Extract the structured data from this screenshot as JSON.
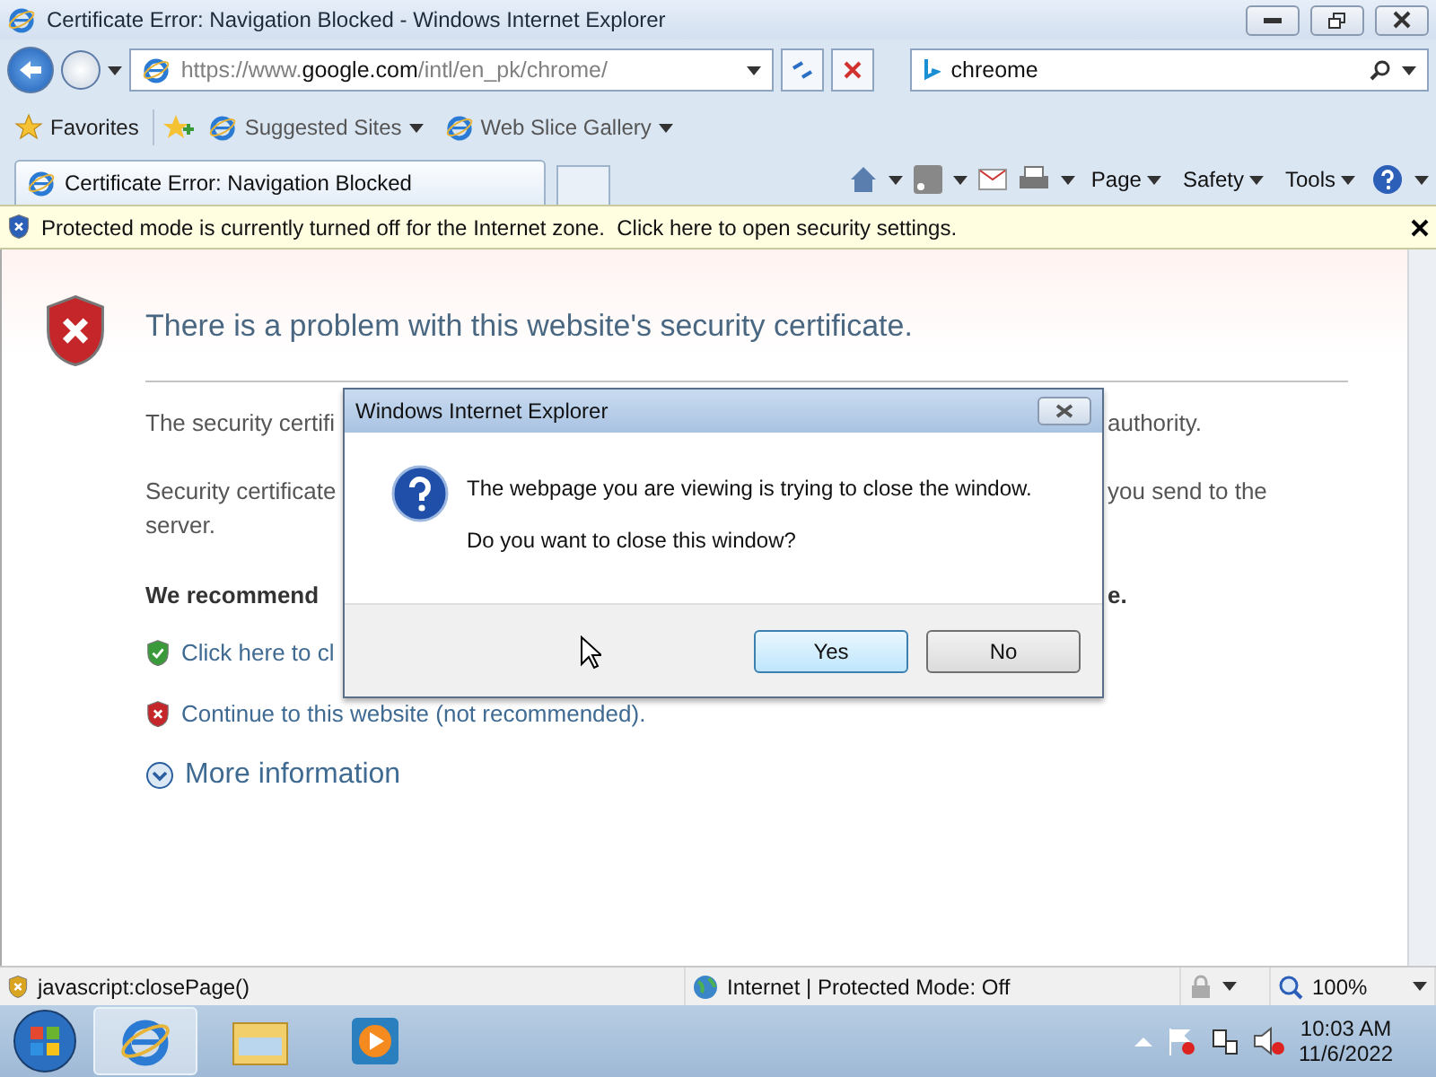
{
  "window": {
    "title": "Certificate Error: Navigation Blocked - Windows Internet Explorer"
  },
  "address_bar": {
    "url": [
      {
        "text": "https://www.",
        "emphasis": false
      },
      {
        "text": "google.com",
        "emphasis": true
      },
      {
        "text": "/intl/en_pk/chrome/",
        "emphasis": false
      }
    ]
  },
  "search": {
    "value": "chreome"
  },
  "favorites_bar": {
    "favorites": "Favorites",
    "links": [
      "Suggested Sites",
      "Web Slice Gallery"
    ]
  },
  "tabs": [
    {
      "label": "Certificate Error: Navigation Blocked",
      "selected": true
    }
  ],
  "command_bar": [
    "Page",
    "Safety",
    "Tools"
  ],
  "info_bar": {
    "message": "Protected mode is currently turned off for the Internet zone.  Click here to open security settings."
  },
  "page": {
    "heading": "There is a problem with this website's security certificate.",
    "rows": [
      {
        "kind": "text",
        "left": "The security certifi",
        "right": "authority."
      },
      {
        "kind": "text",
        "left": "Security certificate",
        "right": "you send to the"
      },
      {
        "kind": "cont",
        "left": "server."
      },
      {
        "kind": "bold",
        "left": "We recommend",
        "right": "e."
      },
      {
        "kind": "safe-link",
        "left": "Click here to cl"
      },
      {
        "kind": "unsafe-link",
        "left": "Continue to this website (not recommended)."
      },
      {
        "kind": "more",
        "left": "More information"
      }
    ]
  },
  "dialog": {
    "title": "Windows Internet Explorer",
    "message": "The webpage you are viewing is trying to close the window.",
    "question": "Do you want to close this window?",
    "buttons": [
      {
        "label": "Yes",
        "default": true
      },
      {
        "label": "No",
        "default": false
      }
    ]
  },
  "status_bar": {
    "url": "javascript:closePage()",
    "zone": "Internet | Protected Mode: Off",
    "zoom": "100%"
  },
  "taskbar": {
    "apps": [
      {
        "kind": "ie",
        "active": true
      },
      {
        "kind": "folder",
        "active": false
      },
      {
        "kind": "media",
        "active": false
      }
    ],
    "time": "10:03 AM",
    "date": "11/6/2022"
  }
}
